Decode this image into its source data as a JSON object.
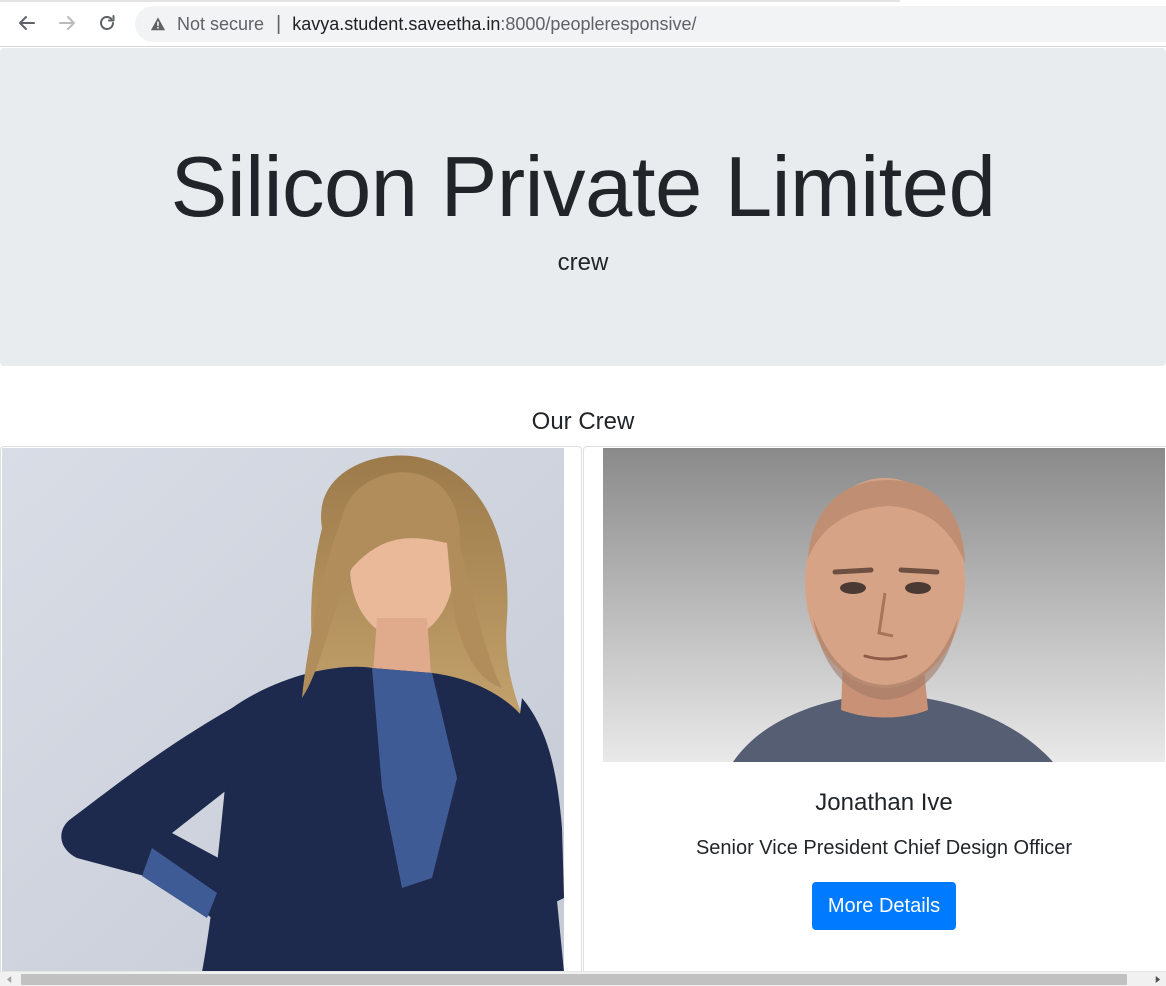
{
  "browser": {
    "security_label": "Not secure",
    "url_host": "kavya.student.saveetha.in",
    "url_path": ":8000/peopleresponsive/",
    "icons": [
      "back-arrow-icon",
      "forward-arrow-icon",
      "reload-icon",
      "warning-triangle-icon"
    ]
  },
  "jumbotron": {
    "title": "Silicon Private Limited",
    "subtitle": "crew"
  },
  "section": {
    "title": "Our Crew"
  },
  "cards": [
    {
      "photo": "woman-in-navy-blazer-photo"
    },
    {
      "photo": "bald-man-portrait-photo",
      "name": "Jonathan Ive",
      "role": "Senior Vice President Chief Design Officer",
      "button_label": "More Details"
    }
  ],
  "colors": {
    "jumbotron_bg": "#e9ecef",
    "primary_button": "#007bff",
    "text": "#212529"
  }
}
